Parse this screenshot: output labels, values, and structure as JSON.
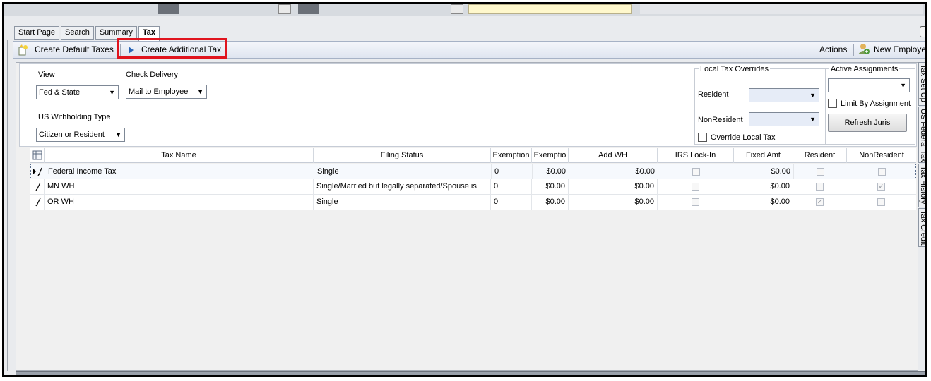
{
  "tabs": [
    {
      "label": "Start Page"
    },
    {
      "label": "Search"
    },
    {
      "label": "Summary"
    },
    {
      "label": "Tax"
    }
  ],
  "toolbar": {
    "create_default": "Create Default Taxes",
    "create_additional": "Create Additional Tax",
    "actions": "Actions",
    "new_employee": "New Employee"
  },
  "settings": {
    "view_label": "View",
    "view_value": "Fed & State",
    "check_delivery_label": "Check Delivery",
    "check_delivery_value": "Mail to Employee",
    "us_withholding_label": "US Withholding Type",
    "us_withholding_value": "Citizen or Resident",
    "local_overrides_label": "Local Tax Overrides",
    "resident_label": "Resident",
    "resident_value": "",
    "nonresident_label": "NonResident",
    "nonresident_value": "",
    "override_local_label": "Override Local Tax",
    "active_assignments_label": "Active Assignments",
    "active_assignments_value": "",
    "limit_by_assignment_label": "Limit By Assignment",
    "refresh_button": "Refresh Juris"
  },
  "grid": {
    "columns": [
      "Tax Name",
      "Filing Status",
      "Exemption",
      "Exemptio",
      "Add WH",
      "IRS Lock-In",
      "Fixed Amt",
      "Resident",
      "NonResident"
    ],
    "rows": [
      {
        "tax_name": "Federal Income Tax",
        "filing_status": "Single",
        "exemption": "0",
        "exemption_amt": "$0.00",
        "add_wh": "$0.00",
        "irs_lock_in": false,
        "fixed_amt": "$0.00",
        "resident": false,
        "nonresident": false
      },
      {
        "tax_name": "MN WH",
        "filing_status": "Single/Married but legally separated/Spouse is",
        "exemption": "0",
        "exemption_amt": "$0.00",
        "add_wh": "$0.00",
        "irs_lock_in": false,
        "fixed_amt": "$0.00",
        "resident": false,
        "nonresident": true
      },
      {
        "tax_name": "OR WH",
        "filing_status": "Single",
        "exemption": "0",
        "exemption_amt": "$0.00",
        "add_wh": "$0.00",
        "irs_lock_in": false,
        "fixed_amt": "$0.00",
        "resident": true,
        "nonresident": false
      }
    ]
  },
  "side_tabs": [
    "Tax Set Up",
    "US Federal Tax",
    "Tax History",
    "Tax Credit"
  ],
  "icons": {
    "create_default": "new-document-icon",
    "create_additional": "play-arrow-icon",
    "new_employee": "add-user-icon",
    "grid_menu": "column-chooser-icon",
    "row_edit": "pencil-icon",
    "row_current": "current-row-arrow-icon"
  },
  "colors": {
    "highlight": "#e0141e",
    "toolbar": "#dfe5f0",
    "accent": "#2a66b8"
  }
}
